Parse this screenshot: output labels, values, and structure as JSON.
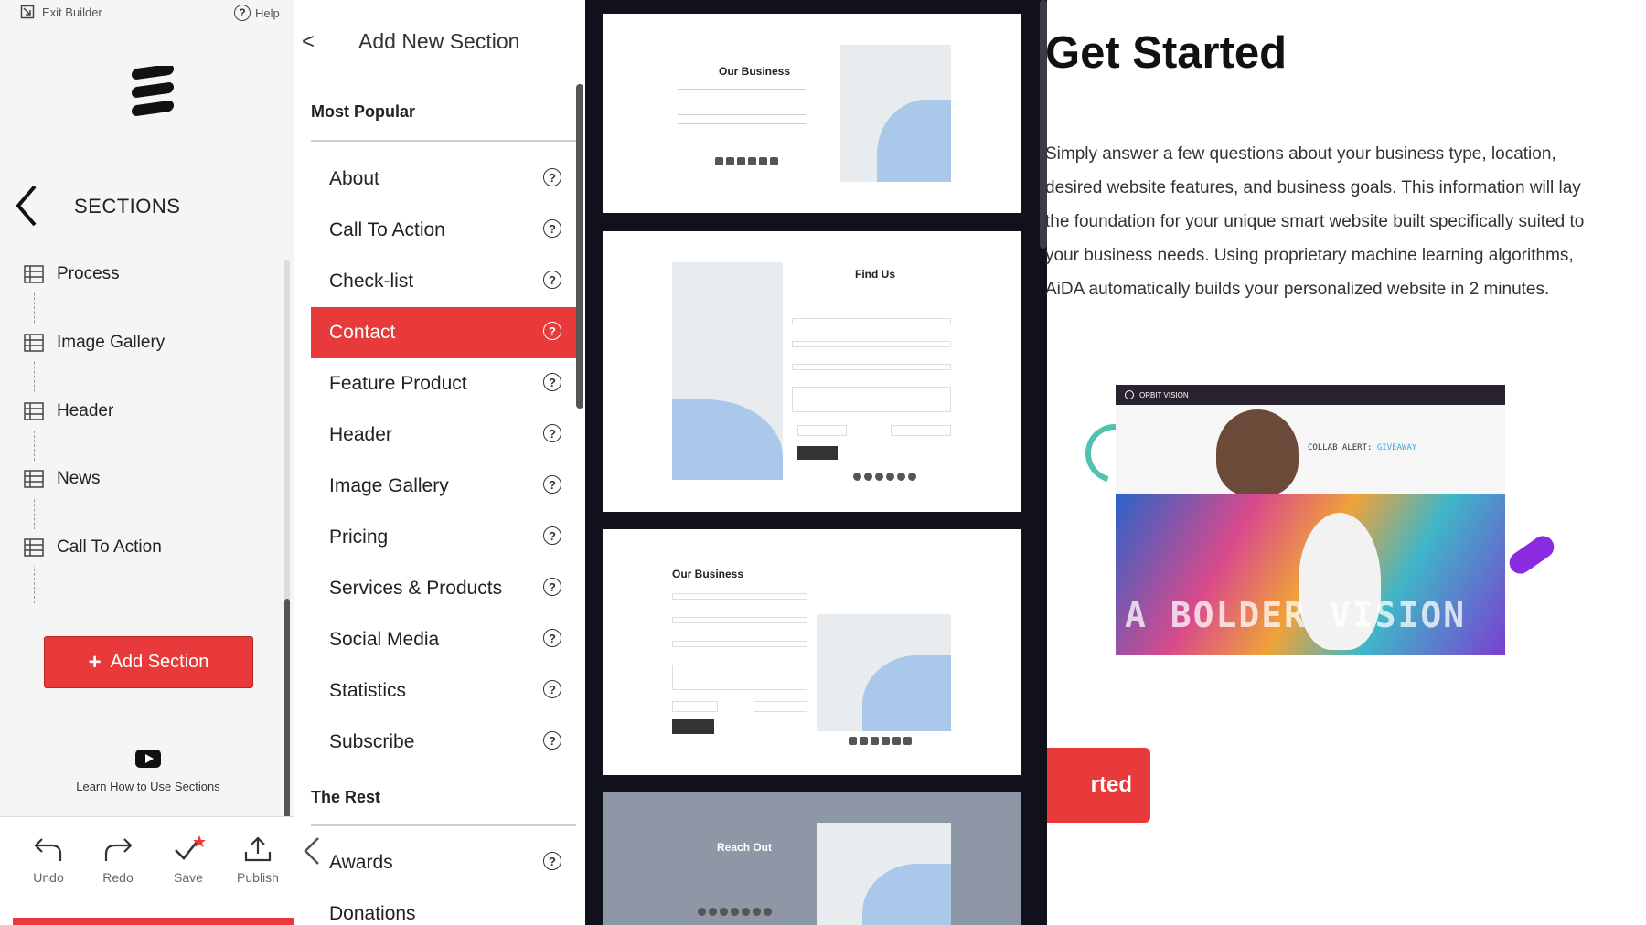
{
  "topbar": {
    "exit_label": "Exit Builder",
    "help_label": "Help"
  },
  "sections_panel": {
    "title": "SECTIONS",
    "items": [
      {
        "label": "Process"
      },
      {
        "label": "Image Gallery"
      },
      {
        "label": "Header"
      },
      {
        "label": "News"
      },
      {
        "label": "Call To Action"
      }
    ],
    "add_button_label": "Add Section",
    "learn_label": "Learn How to Use Sections"
  },
  "toolbar": {
    "undo_label": "Undo",
    "redo_label": "Redo",
    "save_label": "Save",
    "publish_label": "Publish"
  },
  "add_section": {
    "back_label": "<",
    "title": "Add New Section",
    "most_popular_title": "Most Popular",
    "most_popular": [
      {
        "label": "About",
        "help": "?"
      },
      {
        "label": "Call To Action",
        "help": "?"
      },
      {
        "label": "Check-list",
        "help": "?"
      },
      {
        "label": "Contact",
        "help": "?",
        "active": true
      },
      {
        "label": "Feature Product",
        "help": "?"
      },
      {
        "label": "Header",
        "help": "?"
      },
      {
        "label": "Image Gallery",
        "help": "?"
      },
      {
        "label": "Pricing",
        "help": "?"
      },
      {
        "label": "Services & Products",
        "help": "?"
      },
      {
        "label": "Social Media",
        "help": "?"
      },
      {
        "label": "Statistics",
        "help": "?"
      },
      {
        "label": "Subscribe",
        "help": "?"
      }
    ],
    "the_rest_title": "The Rest",
    "the_rest": [
      {
        "label": "Awards",
        "help": "?"
      },
      {
        "label": "Donations"
      }
    ]
  },
  "thumbnails": [
    {
      "title": "Our Business"
    },
    {
      "title": "Find Us"
    },
    {
      "title": "Our Business"
    },
    {
      "title": "Reach Out"
    }
  ],
  "page": {
    "heading": "Get Started",
    "body": "Simply answer a few questions about your business type, location, desired website features, and business goals. This information will lay the foundation for your unique smart website built specifically suited to your business needs. Using proprietary machine learning algorithms, AiDA automatically builds your personalized website in 2 minutes.",
    "cta_label": "rted",
    "hero": {
      "brand": "ORBIT VISION",
      "collab": "COLLAB ALERT:",
      "collab_accent": "GIVEAWAY",
      "caption": "A BOLDER VISION"
    }
  },
  "colors": {
    "accent": "#e83a3a",
    "panel_bg": "#f5f5f5",
    "thumb_bg": "#10111a",
    "map_sea": "#a9c8ea",
    "purple": "#8a2be2",
    "teal": "#4fc3b0"
  },
  "icons": {
    "exit": "exit-icon",
    "help": "help-icon",
    "logo": "stacked-logo-icon",
    "back": "chevron-left-icon",
    "section": "section-layout-icon",
    "add": "plus-icon",
    "video": "youtube-play-icon",
    "undo": "undo-icon",
    "redo": "redo-icon",
    "save": "checkmark-icon",
    "publish": "upload-icon",
    "question": "question-circle-icon"
  }
}
